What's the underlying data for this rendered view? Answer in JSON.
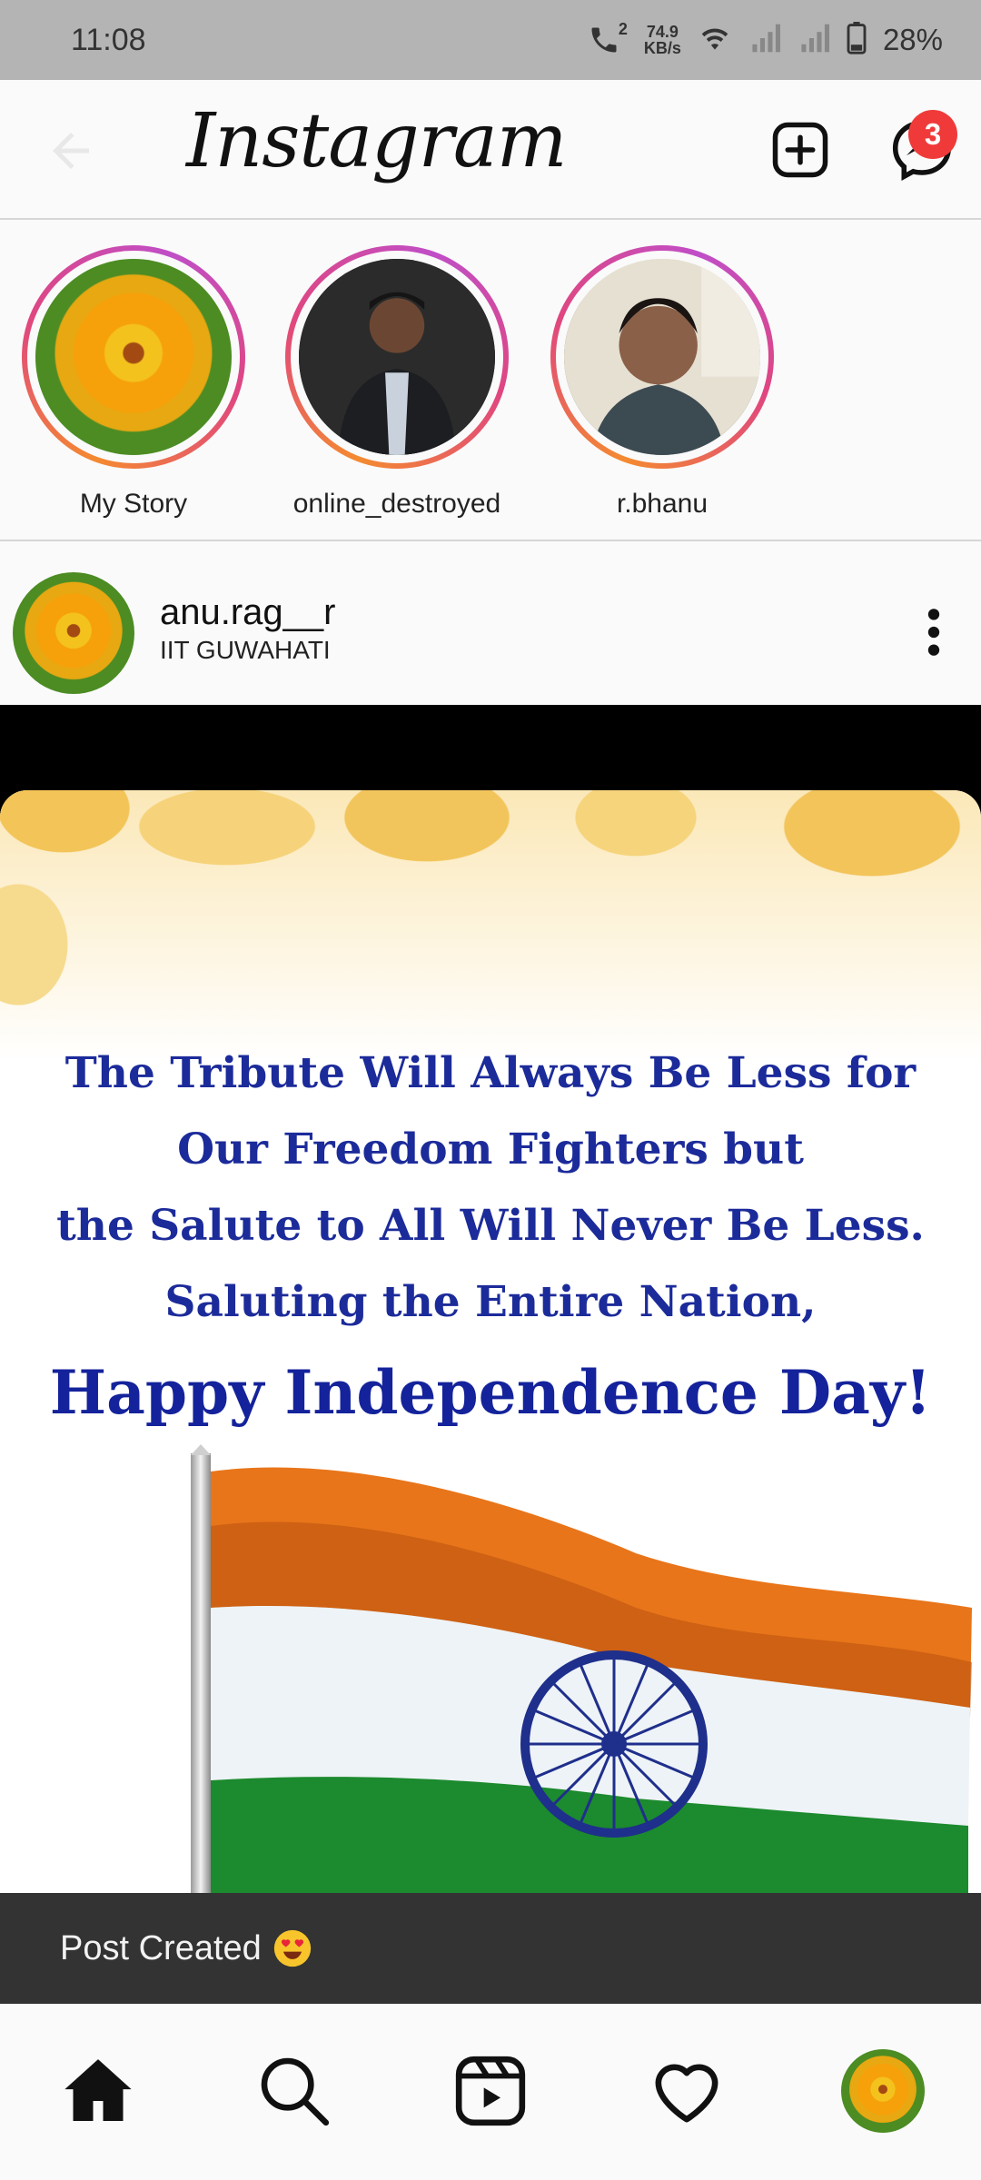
{
  "status_bar": {
    "time": "11:08",
    "net_speed_value": "74.9",
    "net_speed_unit": "KB/s",
    "battery": "28%",
    "call_badge": "2"
  },
  "header": {
    "logo": "Instagram",
    "message_badge": "3"
  },
  "stories": [
    {
      "label": "My Story"
    },
    {
      "label": "online_destroyed"
    },
    {
      "label": "r.bhanu"
    }
  ],
  "post": {
    "username": "anu.rag__r",
    "location": "IIT GUWAHATI",
    "image_text": {
      "line1": "The Tribute Will Always Be Less for",
      "line2": "Our Freedom Fighters but",
      "line3": "the Salute to All Will Never Be Less.",
      "line4": "Saluting the Entire Nation,",
      "title": "Happy Independence Day!"
    }
  },
  "snackbar": {
    "text": "Post Created"
  },
  "bottom_nav": [
    "home-icon",
    "search-icon",
    "reels-icon",
    "heart-icon",
    "profile-avatar"
  ]
}
